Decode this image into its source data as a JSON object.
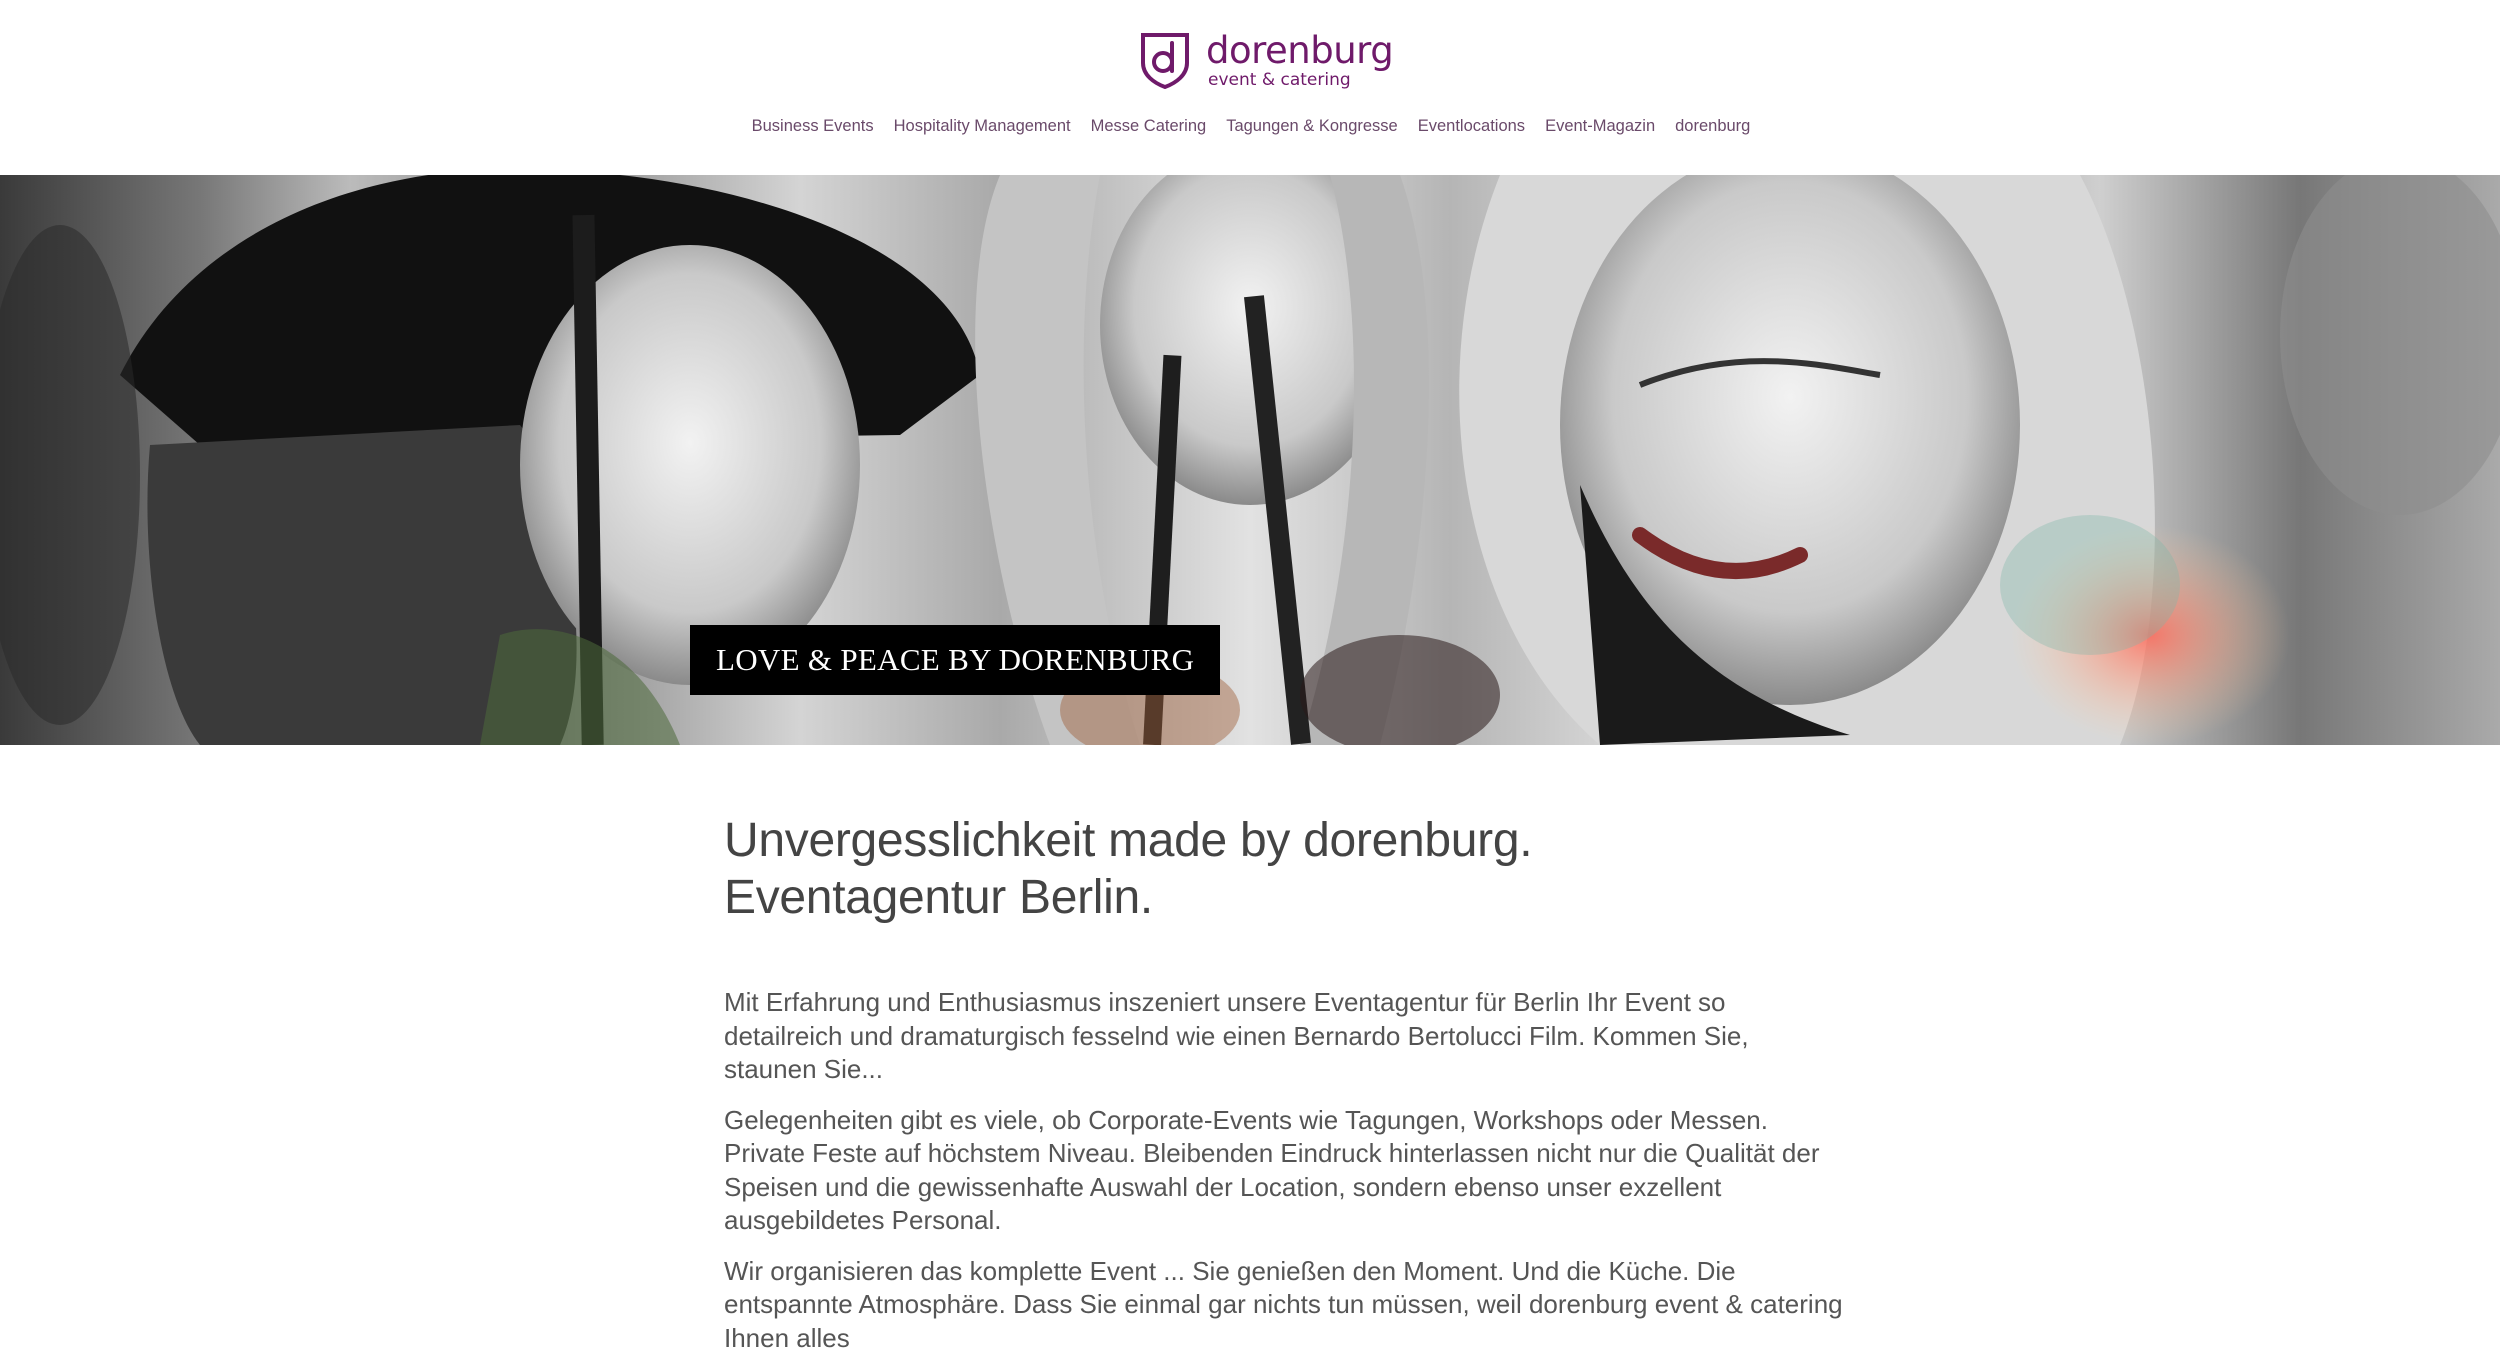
{
  "brand": {
    "name": "dorenburg",
    "tagline": "event & catering",
    "logo_icon": "shield-d-icon",
    "color": "#6f1a6a"
  },
  "nav": {
    "items": [
      {
        "label": "Business Events"
      },
      {
        "label": "Hospitality Management"
      },
      {
        "label": "Messe Catering"
      },
      {
        "label": "Tagungen & Kongresse"
      },
      {
        "label": "Eventlocations"
      },
      {
        "label": "Event-Magazin"
      },
      {
        "label": "dorenburg"
      }
    ]
  },
  "hero": {
    "caption": "LOVE & PEACE BY DORENBURG"
  },
  "main": {
    "title_line1": "Unvergesslichkeit made by dorenburg.",
    "title_line2": "Eventagentur Berlin.",
    "paragraphs": [
      "Mit Erfahrung und Enthusiasmus inszeniert unsere Eventagentur für Berlin Ihr Event so detailreich und dramaturgisch fesselnd wie einen Bernardo Bertolucci Film. Kommen Sie, staunen Sie...",
      "Gelegenheiten gibt es viele, ob Corporate-Events wie Tagungen, Workshops oder Messen. Private Feste auf höchstem Niveau. Bleibenden Eindruck hinterlassen nicht nur die Qualität der Speisen und die gewissenhafte Auswahl der Location, sondern ebenso unser exzellent ausgebildetes Personal.",
      "Wir organisieren das komplette Event ... Sie genießen den Moment. Und die Küche. Die entspannte Atmosphäre. Dass Sie einmal gar nichts tun müssen, weil dorenburg event & catering Ihnen alles"
    ]
  }
}
